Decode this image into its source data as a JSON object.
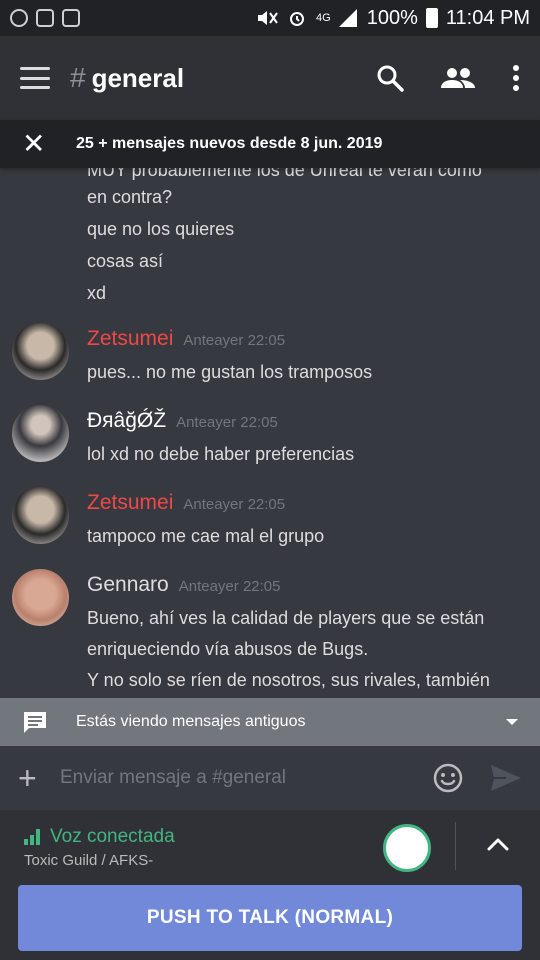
{
  "status_bar": {
    "battery": "100%",
    "time": "11:04 PM",
    "network": "4G",
    "icons": [
      "whatsapp-icon",
      "image-icon",
      "discord-icon",
      "mute-icon",
      "alarm-icon",
      "signal-icon",
      "battery-icon"
    ]
  },
  "header": {
    "hash": "#",
    "channel": "general",
    "icons": [
      "menu-icon",
      "search-icon",
      "members-icon",
      "more-icon"
    ]
  },
  "new_messages": {
    "text": "25 + mensajes nuevos desde 8 jun. 2019"
  },
  "partial_message": {
    "lines": [
      "MUY probablemente los de Unreal te verán como",
      "en contra?",
      "que no los quieres",
      "cosas así",
      "xd"
    ]
  },
  "messages": [
    {
      "author": "Zetsumei",
      "author_color": "#f04747",
      "time": "Anteayer 22:05",
      "lines": [
        "pues... no me gustan los tramposos"
      ]
    },
    {
      "author": "ĐяâğǾŽ",
      "author_color": "#ffffff",
      "time": "Anteayer 22:05",
      "lines": [
        "lol xd no debe haber preferencias"
      ]
    },
    {
      "author": "Zetsumei",
      "author_color": "#f04747",
      "time": "Anteayer 22:05",
      "lines": [
        "tampoco me cae mal el grupo"
      ]
    },
    {
      "author": "Gennaro",
      "author_color": "#dcddde",
      "time": "Anteayer 22:05",
      "lines": [
        "Bueno, ahí ves la calidad de players que se están",
        "enriqueciendo vía abusos de Bugs.",
        "Y no solo se ríen de nosotros, sus rivales, también"
      ]
    }
  ],
  "old_messages": {
    "text": "Estás viendo mensajes antiguos"
  },
  "composer": {
    "placeholder": "Enviar mensaje a #general"
  },
  "voice": {
    "status": "Voz conectada",
    "channel": "Toxic Guild / AFKS-",
    "push_to_talk": "PUSH TO TALK (NORMAL)"
  },
  "colors": {
    "background": "#36393f",
    "header": "#2f3136",
    "accent": "#7289da",
    "connected": "#43b581",
    "mention_red": "#f04747"
  }
}
